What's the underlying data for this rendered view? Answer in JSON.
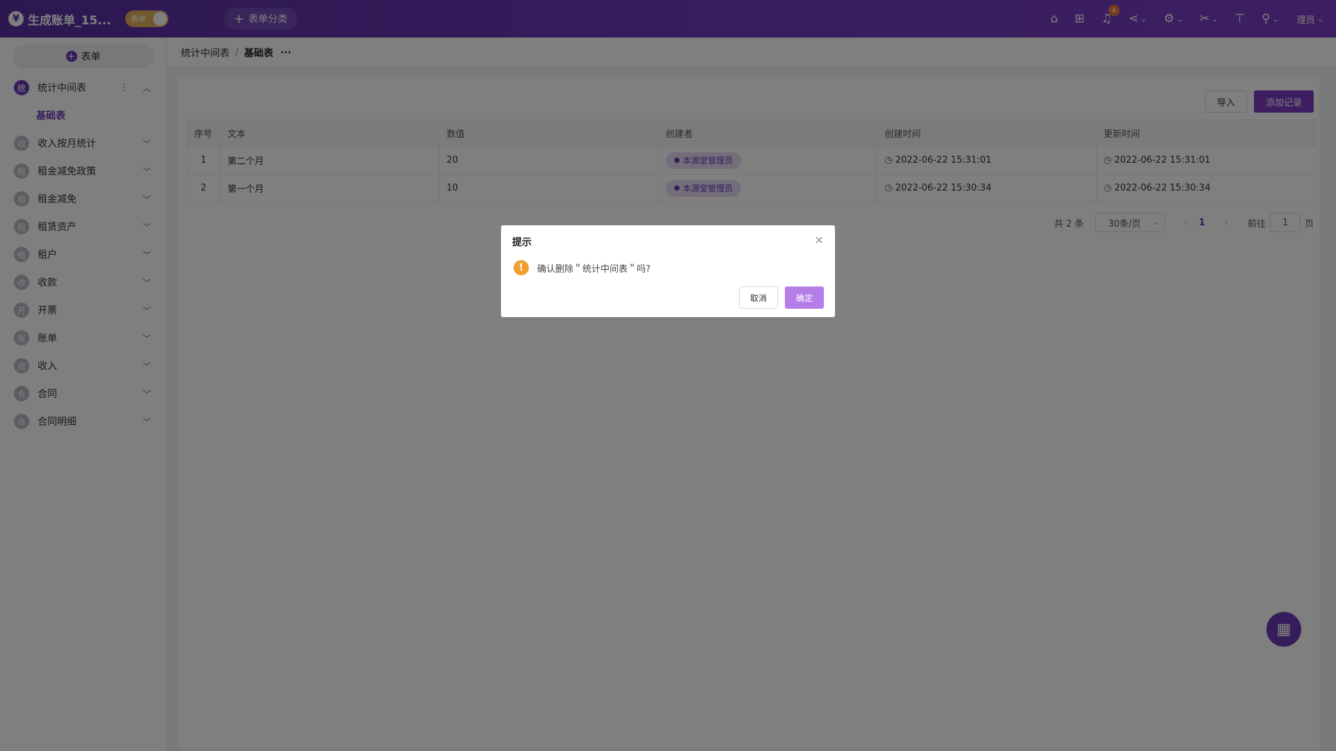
{
  "app": {
    "title": "生成账单_15...",
    "brand_glyph": "¥",
    "mode_toggle_label": "表单",
    "category_button": "表单分类",
    "notification_count": "4",
    "user_label": "理员"
  },
  "sidebar": {
    "add_form_label": "表单",
    "items": [
      {
        "glyph": "统",
        "label": "统计中间表",
        "expanded": true
      },
      {
        "glyph": "收",
        "label": "收入按月统计"
      },
      {
        "glyph": "租",
        "label": "租金减免政策"
      },
      {
        "glyph": "租",
        "label": "租金减免"
      },
      {
        "glyph": "租",
        "label": "租赁资产"
      },
      {
        "glyph": "租",
        "label": "租户"
      },
      {
        "glyph": "收",
        "label": "收款"
      },
      {
        "glyph": "开",
        "label": "开票"
      },
      {
        "glyph": "账",
        "label": "账单"
      },
      {
        "glyph": "收",
        "label": "收入"
      },
      {
        "glyph": "合",
        "label": "合同"
      },
      {
        "glyph": "合",
        "label": "合同明细"
      }
    ],
    "sub_item": "基础表"
  },
  "breadcrumb": {
    "parent": "统计中间表",
    "separator": "/",
    "current": "基础表",
    "more": "···"
  },
  "toolbar": {
    "import_label": "导入",
    "add_record_label": "添加记录"
  },
  "table": {
    "headers": [
      "序号",
      "文本",
      "数值",
      "创建者",
      "创建时间",
      "更新时间"
    ],
    "rows": [
      {
        "idx": "1",
        "text": "第二个月",
        "value": "20",
        "creator": "本源堂管理员",
        "created": "2022-06-22 15:31:01",
        "updated": "2022-06-22 15:31:01"
      },
      {
        "idx": "2",
        "text": "第一个月",
        "value": "10",
        "creator": "本源堂管理员",
        "created": "2022-06-22 15:30:34",
        "updated": "2022-06-22 15:30:34"
      }
    ]
  },
  "pager": {
    "total": "共 2 条",
    "page_size": "30条/页",
    "current_page": "1",
    "goto_label": "前往",
    "goto_value": "1",
    "page_suffix": "页"
  },
  "dialog": {
    "title": "提示",
    "message": "确认删除＂统计中间表＂吗?",
    "cancel_label": "取消",
    "ok_label": "确定"
  },
  "colors": {
    "brand": "#6b3ab8",
    "overlay": "rgba(0,0,0,0.5)",
    "warning": "#f0a032"
  }
}
